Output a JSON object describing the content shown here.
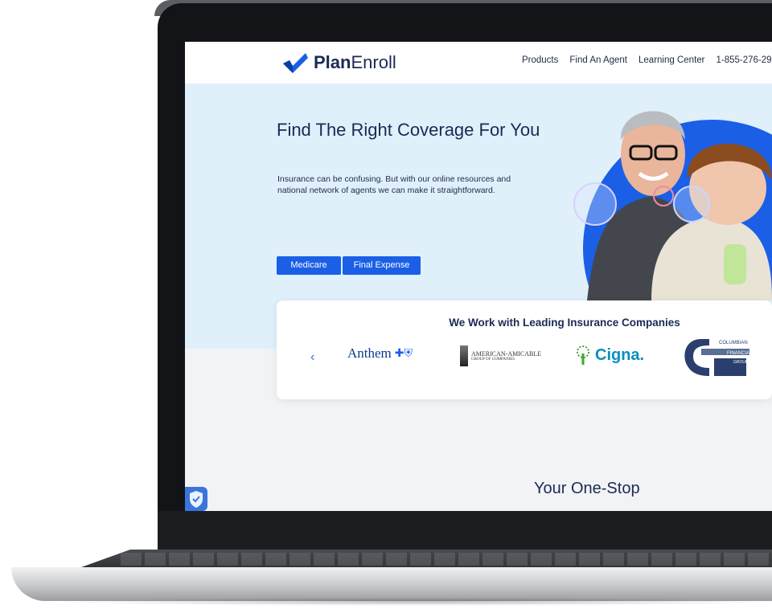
{
  "brand": {
    "name_bold": "Plan",
    "name_light": "Enroll",
    "color": "#1b2a55",
    "check_color": "#1a5fe6"
  },
  "nav": {
    "products": "Products",
    "find_agent": "Find An Agent",
    "learning": "Learning Center",
    "phone": "1-855-276-29"
  },
  "hero": {
    "title": "Find The Right Coverage For You",
    "text": "Insurance can be confusing. But with our online resources and national network of agents we can make it straightforward.",
    "btn_medicare": "Medicare",
    "btn_final": "Final Expense",
    "bg_color": "#dff0fb"
  },
  "partners": {
    "title": "We Work with Leading Insurance Companies",
    "prev": "‹",
    "logos": {
      "anthem": "Anthem",
      "american_amicable_line1": "AMERICAN-AMICABLE",
      "american_amicable_line2": "GROUP OF COMPANIES",
      "cigna": "Cigna.",
      "cfg_line1": "COLUMBIAN",
      "cfg_line2": "FINANCIAL",
      "cfg_line3": "GROUP"
    }
  },
  "section": {
    "title": "Your One-Stop"
  },
  "icons": {
    "logo_check": "checkmark-icon",
    "prev": "chevron-left-icon",
    "shield": "shield-check-icon"
  }
}
